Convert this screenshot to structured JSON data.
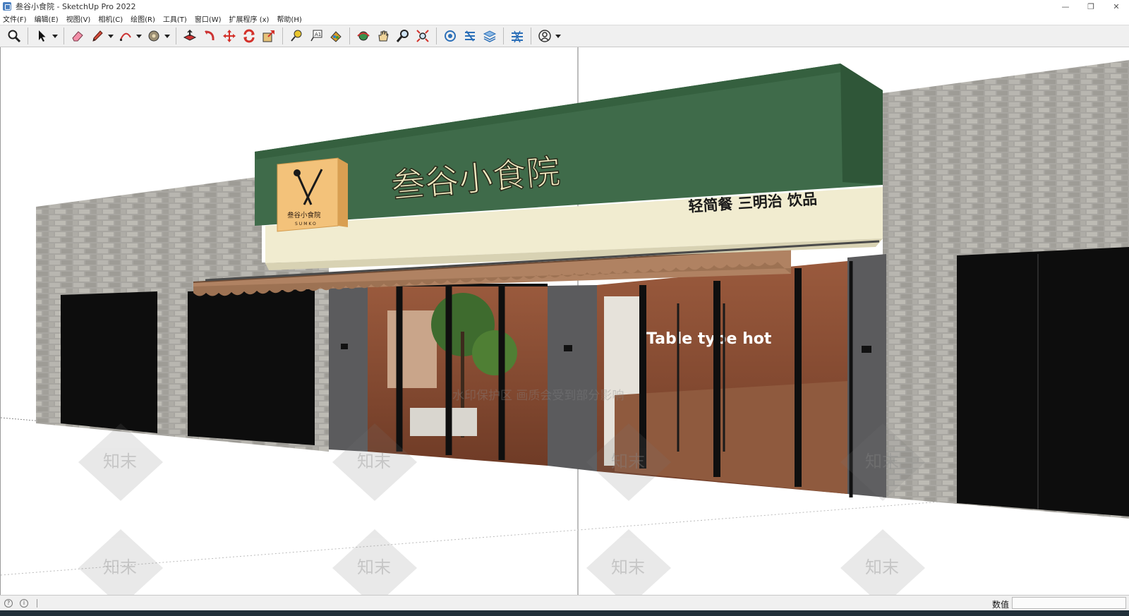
{
  "window": {
    "title": "叁谷小食院 - SketchUp Pro 2022",
    "minimize": "—",
    "restore": "❐",
    "close": "✕"
  },
  "menu": {
    "items": [
      "文件(F)",
      "编辑(E)",
      "视图(V)",
      "相机(C)",
      "绘图(R)",
      "工具(T)",
      "窗口(W)",
      "扩展程序 (x)",
      "帮助(H)"
    ]
  },
  "toolbar": {
    "icons": [
      "zoom-icon",
      "select-arrow-icon",
      "eraser-icon",
      "pencil-icon",
      "arc-icon",
      "paint-bucket-icon",
      "push-pull-icon",
      "follow-me-icon",
      "move-icon",
      "rotate-icon",
      "scale-icon",
      "tape-measure-icon",
      "text-icon",
      "paint-icon",
      "orbit-icon",
      "pan-icon",
      "zoom-glass-icon",
      "zoom-extents-icon",
      "warehouse-icon",
      "extension-icon",
      "layers-icon",
      "sandbox-icon",
      "user-icon"
    ]
  },
  "scene": {
    "sign_title": "叁谷小食院",
    "sign_subtitle": "轻简餐 三明治 饮品",
    "logo_text": "叁谷小食院",
    "logo_sub": "SUMKO",
    "window_text": "Table type hot",
    "watermark_text": "水印保护区   画质会受到部分影响",
    "watermark_brand": "知末"
  },
  "status": {
    "measurement_label": "数值",
    "measurement_value": "",
    "hint_separator": "|"
  },
  "colors": {
    "sign_green": "#3f6b4a",
    "sign_cream": "#f1ecd0",
    "brick": "#a9a7a2",
    "awning": "#b08262",
    "interior": "#8a4f36",
    "pillar": "#5c5c5e",
    "sign_text": "#f3ecc2"
  }
}
